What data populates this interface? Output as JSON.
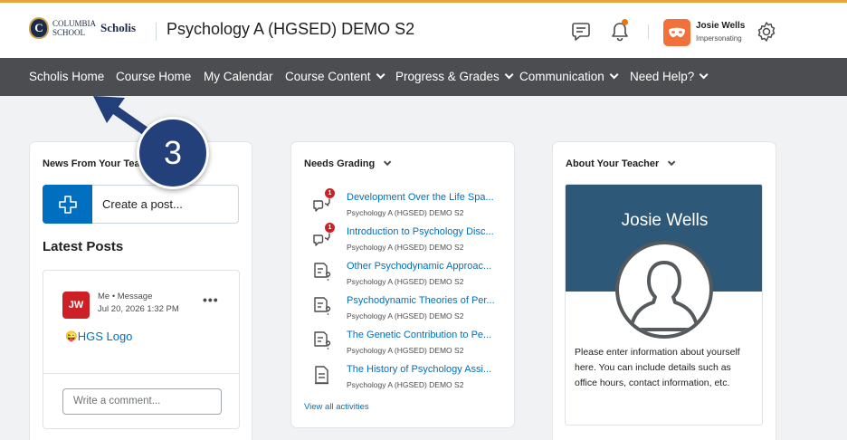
{
  "header": {
    "logo": {
      "line1": "COLUMBIA",
      "line2": "SCHOOL",
      "brand": "Scholis",
      "seal_letter": "C"
    },
    "course_title": "Psychology A (HGSED) DEMO S2",
    "icons": [
      "message-alerts-icon",
      "bell-icon",
      "gear-icon"
    ],
    "user": {
      "name": "Josie Wells",
      "status": "Impersonating"
    },
    "accent_color": "#f2703a"
  },
  "navbar": {
    "items": [
      {
        "label": "Scholis Home",
        "has_menu": false
      },
      {
        "label": "Course Home",
        "has_menu": false
      },
      {
        "label": "My Calendar",
        "has_menu": false
      },
      {
        "label": "Course Content",
        "has_menu": true
      },
      {
        "label": "Progress & Grades",
        "has_menu": true
      },
      {
        "label": "Communication",
        "has_menu": true
      },
      {
        "label": "Need Help?",
        "has_menu": true
      }
    ]
  },
  "news": {
    "title": "News From Your Tea",
    "create_post": "Create a post...",
    "latest_posts": "Latest Posts",
    "post": {
      "avatar_initials": "JW",
      "meta": "Me • Message",
      "date": "Jul 20, 2026 1:32 PM",
      "more": "•••",
      "link_emoji": "😜",
      "link_text": "HGS Logo"
    },
    "comment_placeholder": "Write a comment..."
  },
  "grading": {
    "title": "Needs Grading",
    "items": [
      {
        "title": "Development Over the Life Spa...",
        "course": "Psychology A (HGSED) DEMO S2",
        "icon": "discussion-icon",
        "badge": "1"
      },
      {
        "title": "Introduction to Psychology Disc...",
        "course": "Psychology A (HGSED) DEMO S2",
        "icon": "discussion-icon",
        "badge": "1"
      },
      {
        "title": "Other Psychodynamic Approac...",
        "course": "Psychology A (HGSED) DEMO S2",
        "icon": "quiz-icon",
        "badge": ""
      },
      {
        "title": "Psychodynamic Theories of Per...",
        "course": "Psychology A (HGSED) DEMO S2",
        "icon": "quiz-icon",
        "badge": ""
      },
      {
        "title": "The Genetic Contribution to Pe...",
        "course": "Psychology A (HGSED) DEMO S2",
        "icon": "quiz-icon",
        "badge": ""
      },
      {
        "title": "The History of Psychology Assi...",
        "course": "Psychology A (HGSED) DEMO S2",
        "icon": "assignment-icon",
        "badge": ""
      }
    ],
    "view_all": "View all activities"
  },
  "teacher": {
    "title": "About Your Teacher",
    "name": "Josie Wells",
    "description": "Please enter information about yourself here. You can include details such as office hours, contact information, etc."
  },
  "overlay": {
    "step_number": "3"
  }
}
